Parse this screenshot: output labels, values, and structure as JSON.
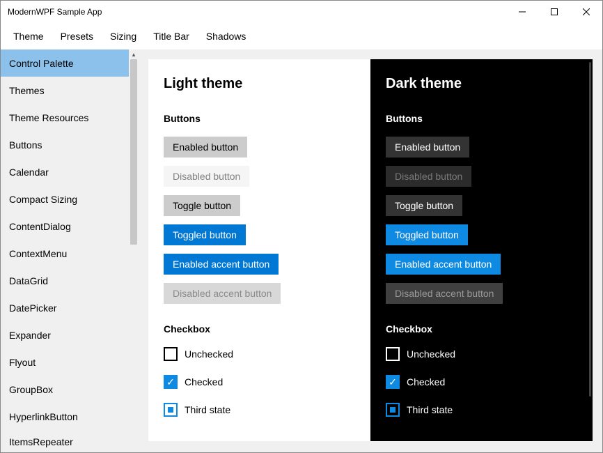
{
  "window": {
    "title": "ModernWPF Sample App"
  },
  "menubar": [
    "Theme",
    "Presets",
    "Sizing",
    "Title Bar",
    "Shadows"
  ],
  "sidebar": {
    "items": [
      "Control Palette",
      "Themes",
      "Theme Resources",
      "Buttons",
      "Calendar",
      "Compact Sizing",
      "ContentDialog",
      "ContextMenu",
      "DataGrid",
      "DatePicker",
      "Expander",
      "Flyout",
      "GroupBox",
      "HyperlinkButton",
      "ItemsRepeater"
    ],
    "selected_index": 0
  },
  "content": {
    "light": {
      "title": "Light theme",
      "sections": {
        "buttons": {
          "heading": "Buttons",
          "items": [
            {
              "label": "Enabled button",
              "style": "default",
              "enabled": true
            },
            {
              "label": "Disabled button",
              "style": "disabled",
              "enabled": false
            },
            {
              "label": "Toggle button",
              "style": "default",
              "enabled": true
            },
            {
              "label": "Toggled button",
              "style": "toggled",
              "enabled": true
            },
            {
              "label": "Enabled accent button",
              "style": "accent",
              "enabled": true
            },
            {
              "label": "Disabled accent button",
              "style": "accent-disabled",
              "enabled": false
            }
          ]
        },
        "checkbox": {
          "heading": "Checkbox",
          "items": [
            {
              "label": "Unchecked",
              "state": "unchecked"
            },
            {
              "label": "Checked",
              "state": "checked"
            },
            {
              "label": "Third state",
              "state": "third"
            }
          ]
        }
      }
    },
    "dark": {
      "title": "Dark theme",
      "sections": {
        "buttons": {
          "heading": "Buttons",
          "items": [
            {
              "label": "Enabled button",
              "style": "default",
              "enabled": true
            },
            {
              "label": "Disabled button",
              "style": "disabled",
              "enabled": false
            },
            {
              "label": "Toggle button",
              "style": "default",
              "enabled": true
            },
            {
              "label": "Toggled button",
              "style": "toggled",
              "enabled": true
            },
            {
              "label": "Enabled accent button",
              "style": "accent",
              "enabled": true
            },
            {
              "label": "Disabled accent button",
              "style": "accent-disabled",
              "enabled": false
            }
          ]
        },
        "checkbox": {
          "heading": "Checkbox",
          "items": [
            {
              "label": "Unchecked",
              "state": "unchecked"
            },
            {
              "label": "Checked",
              "state": "checked"
            },
            {
              "label": "Third state",
              "state": "third"
            }
          ]
        }
      }
    }
  },
  "colors": {
    "accent": "#0078d4",
    "accent_dark": "#0f8ae2",
    "selected": "#8cc1ec"
  }
}
